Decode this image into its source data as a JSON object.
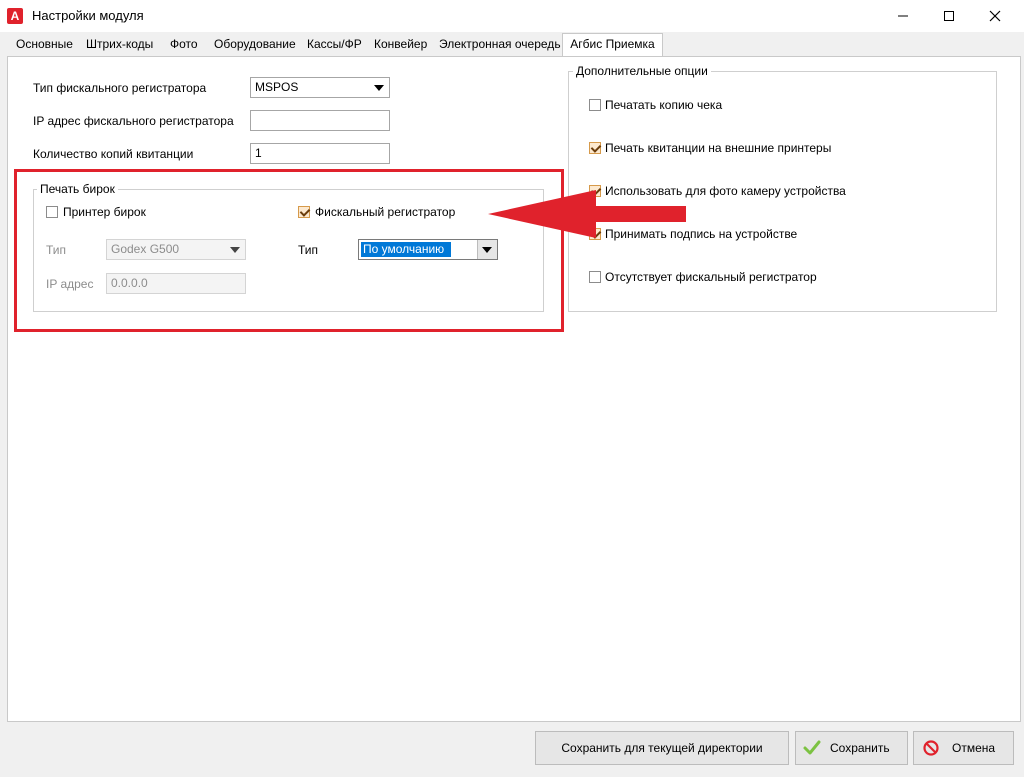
{
  "window": {
    "title": "Настройки модуля",
    "minimize_glyph": "–",
    "maximize_glyph": "☐",
    "close_glyph": "✕"
  },
  "tabs": [
    {
      "label": "Основные"
    },
    {
      "label": "Штрих-коды"
    },
    {
      "label": "Фото"
    },
    {
      "label": "Оборудование"
    },
    {
      "label": "Кассы/ФР"
    },
    {
      "label": "Конвейер"
    },
    {
      "label": "Электронная очередь"
    },
    {
      "label": "Агбис Приемка",
      "active": true
    }
  ],
  "fiscal": {
    "type_label": "Тип фискального регистратора",
    "type_value": "MSPOS",
    "ip_label": "IP адрес фискального регистратора",
    "ip_value": "",
    "copies_label": "Количество копий квитанции",
    "copies_value": "1"
  },
  "tag_print": {
    "title": "Печать бирок",
    "printer_label": "Принтер бирок",
    "printer_checked": false,
    "fiscal_label": "Фискальный регистратор",
    "fiscal_checked": true,
    "printer_type_label": "Тип",
    "printer_type_value": "Godex G500",
    "printer_ip_label": "IP адрес",
    "printer_ip_value": "0.0.0.0",
    "fiscal_type_label": "Тип",
    "fiscal_type_value": "По умолчанию"
  },
  "extra_options": {
    "title": "Дополнительные опции",
    "items": [
      {
        "label": "Печатать копию чека",
        "checked": false
      },
      {
        "label": "Печать квитанции на внешние принтеры",
        "checked": true
      },
      {
        "label": "Использовать для фото камеру устройства",
        "checked": true
      },
      {
        "label": "Принимать подпись на устройстве",
        "checked": true
      },
      {
        "label": "Отсутствует фискальный регистратор",
        "checked": false
      }
    ]
  },
  "buttons": {
    "save_dir": "Сохранить для текущей директории",
    "save": "Сохранить",
    "cancel": "Отмена"
  },
  "colors": {
    "highlight_red": "#e0222c",
    "selection_blue": "#0078d7",
    "check_green": "#7cc242"
  }
}
